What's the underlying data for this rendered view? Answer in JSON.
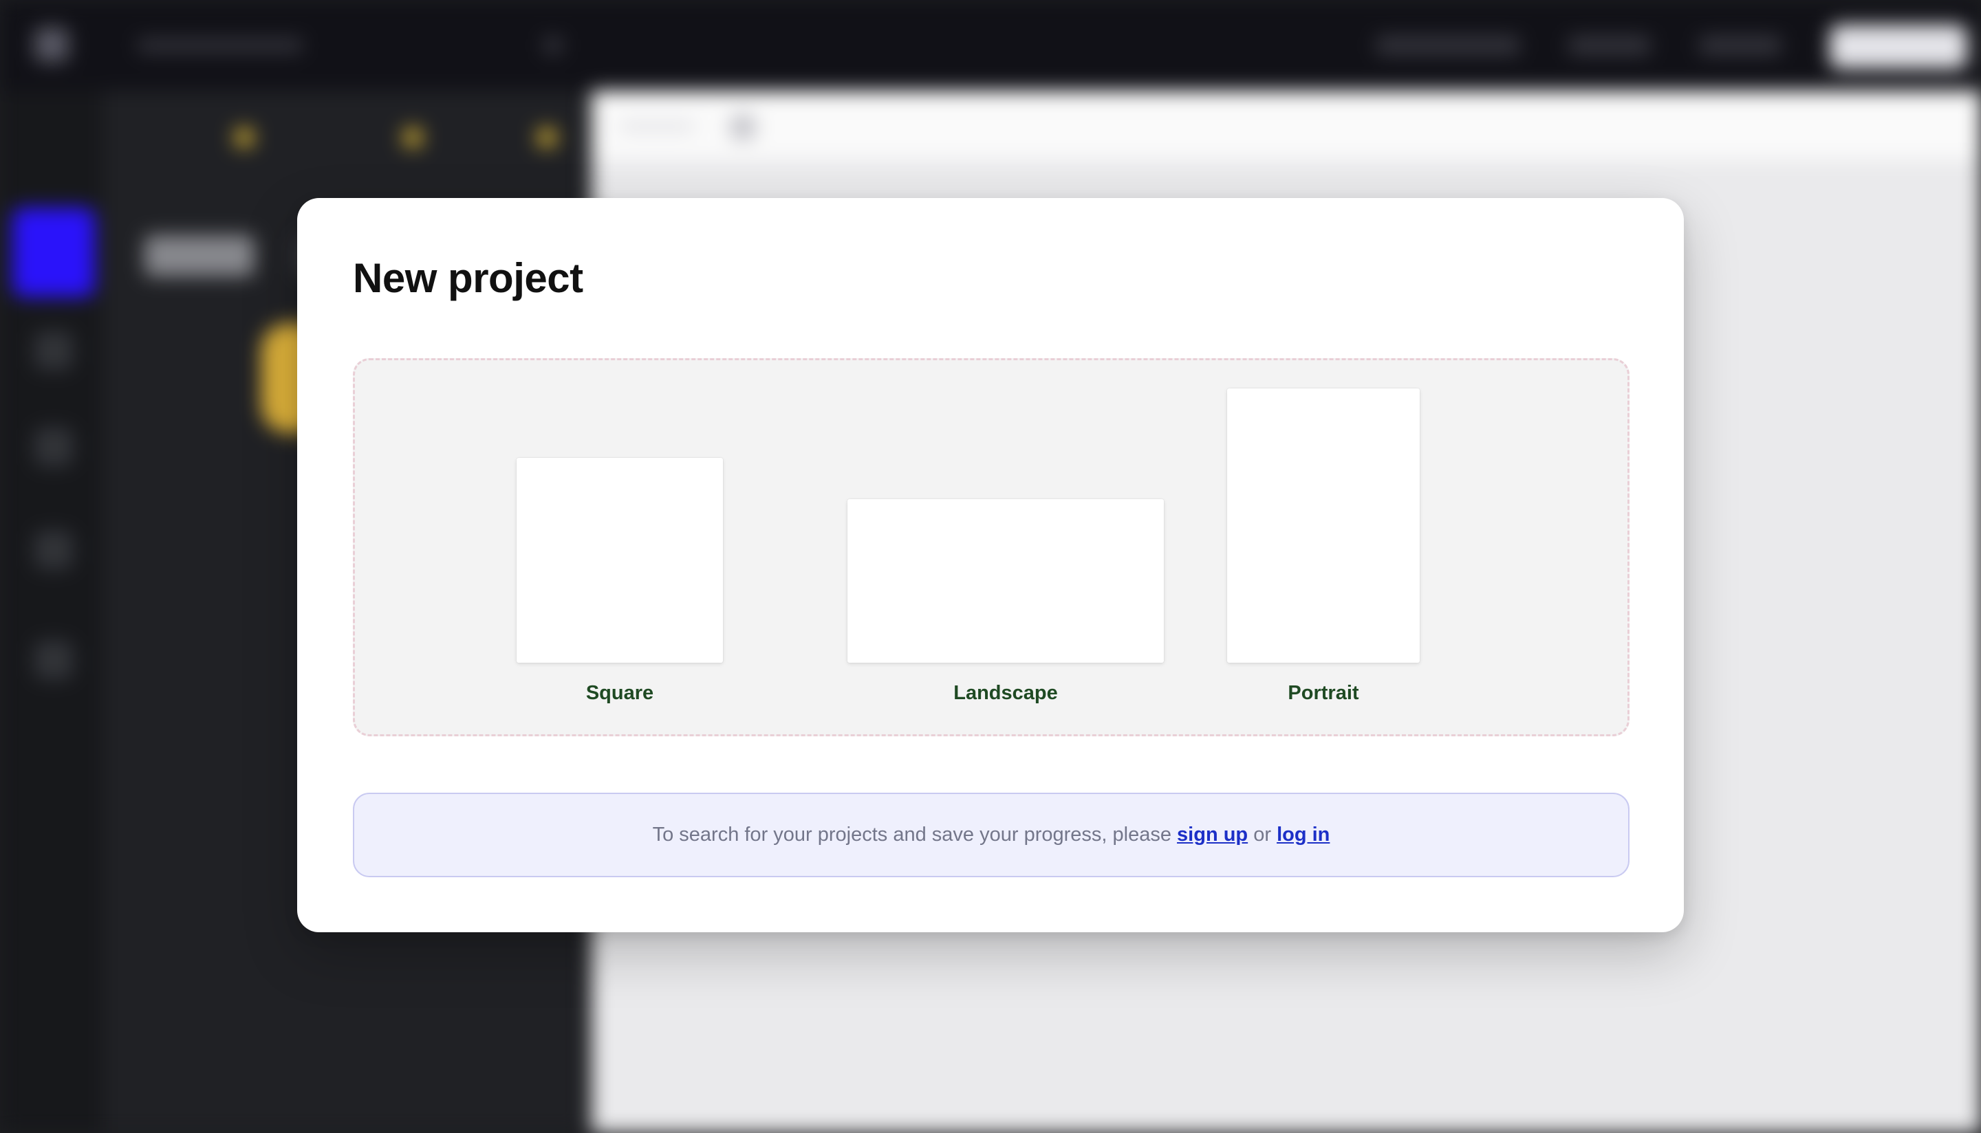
{
  "modal": {
    "title": "New project",
    "formats": [
      {
        "label": "Square"
      },
      {
        "label": "Landscape"
      },
      {
        "label": "Portrait"
      }
    ],
    "notice": {
      "text_before": "To search for your projects and save your progress, please ",
      "signup_link": "sign up",
      "text_middle": " or ",
      "login_link": "log in"
    }
  },
  "colors": {
    "modal_background": "#ffffff",
    "formats_background": "#f3f3f3",
    "formats_border": "#e9cfd6",
    "format_label": "#1f4a23",
    "notice_background": "#eff0fd",
    "notice_border": "#c9caf1",
    "notice_text": "#73768a",
    "link": "#1c2fc7",
    "app_accent": "#2b14ff"
  }
}
